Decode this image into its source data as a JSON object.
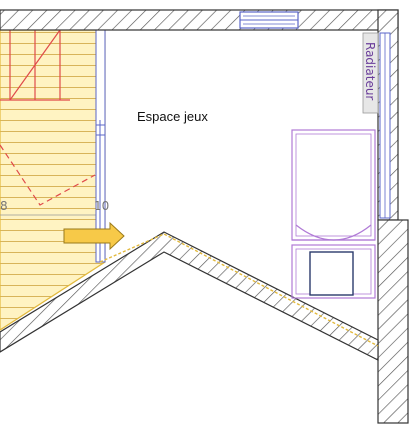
{
  "plan": {
    "room_label": "Espace jeux",
    "radiator_label": "Radiateur",
    "dimension_labels": [
      "8",
      "10"
    ],
    "arrow_icon": "arrow-right-icon",
    "colors": {
      "wall_hatch": "#555555",
      "stair_fill": "#fff3c2",
      "stair_lines": "#d8b45a",
      "stair_edge": "#e2b93c",
      "red_lines": "#e04a4a",
      "furniture": "#b07ad6",
      "window": "#5a66c8",
      "arrow_fill": "#f7c948",
      "arrow_stroke": "#9a7a1a",
      "radiator_bg": "#e7e7e7"
    }
  }
}
